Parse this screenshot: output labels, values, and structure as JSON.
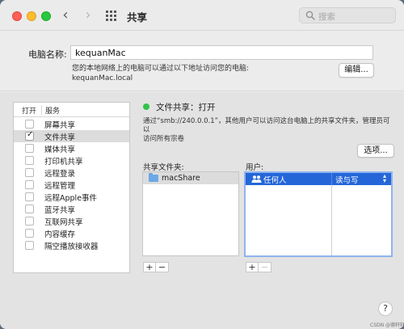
{
  "window": {
    "title": "共享",
    "search_placeholder": "搜索",
    "nav_back": "‹",
    "nav_forward": "›"
  },
  "computer": {
    "name_label": "电脑名称:",
    "name_value": "kequanMac",
    "description_line1": "您的本地网络上的电脑可以通过以下地址访问您的电脑:",
    "description_line2": "kequanMac.local",
    "edit_button": "编辑..."
  },
  "services": {
    "header_on": "打开",
    "header_service": "服务",
    "items": [
      {
        "label": "屏幕共享",
        "checked": false,
        "selected": false
      },
      {
        "label": "文件共享",
        "checked": true,
        "selected": true
      },
      {
        "label": "媒体共享",
        "checked": false,
        "selected": false
      },
      {
        "label": "打印机共享",
        "checked": false,
        "selected": false
      },
      {
        "label": "远程登录",
        "checked": false,
        "selected": false
      },
      {
        "label": "远程管理",
        "checked": false,
        "selected": false
      },
      {
        "label": "远程Apple事件",
        "checked": false,
        "selected": false
      },
      {
        "label": "蓝牙共享",
        "checked": false,
        "selected": false
      },
      {
        "label": "互联网共享",
        "checked": false,
        "selected": false
      },
      {
        "label": "内容缓存",
        "checked": false,
        "selected": false
      },
      {
        "label": "隔空播放接收器",
        "checked": false,
        "selected": false
      }
    ]
  },
  "file_sharing": {
    "status": "文件共享：打开",
    "status_color": "#32c448",
    "info_line1": "通过“smb://240.0.0.1”，其他用户可以访问这台电脑上的共享文件夹，管理员可以",
    "info_line2": "访问所有宗卷",
    "options_button": "选项...",
    "folders_label": "共享文件夹:",
    "users_label": "用户:",
    "folders": [
      "macShare"
    ],
    "users": [
      {
        "name": "任何人",
        "permission": "读与写"
      }
    ],
    "add_label": "+",
    "remove_label": "−"
  },
  "help_label": "?",
  "watermark": "CSDN @德轩轩"
}
